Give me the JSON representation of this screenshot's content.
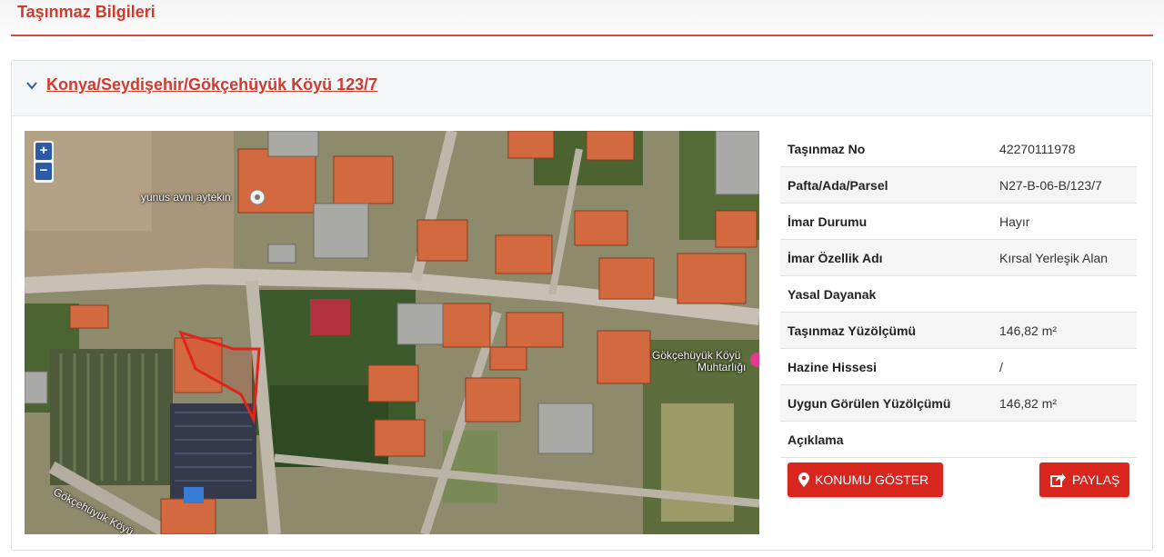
{
  "page": {
    "title": "Taşınmaz Bilgileri"
  },
  "panel": {
    "header_link": "Konya/Seydişehir/Gökçehüyük Köyü 123/7"
  },
  "map": {
    "zoom_in": "+",
    "zoom_out": "−",
    "labels": {
      "poi_user": "yunus avni aytekin",
      "poi_office_line1": "Gökçehüyük Köyü",
      "poi_office_line2": "Muhtarlığı",
      "road": "Gökçehüyük Köyü"
    }
  },
  "details": {
    "rows": [
      {
        "label": "Taşınmaz No",
        "value": "42270111978"
      },
      {
        "label": "Pafta/Ada/Parsel",
        "value": "N27-B-06-B/123/7"
      },
      {
        "label": "İmar Durumu",
        "value": "Hayır"
      },
      {
        "label": "İmar Özellik Adı",
        "value": "Kırsal Yerleşik Alan"
      },
      {
        "label": "Yasal Dayanak",
        "value": ""
      },
      {
        "label": "Taşınmaz Yüzölçümü",
        "value": "146,82 m²"
      },
      {
        "label": "Hazine Hissesi",
        "value": "/"
      },
      {
        "label": "Uygun Görülen Yüzölçümü",
        "value": "146,82 m²"
      },
      {
        "label": "Açıklama",
        "value": ""
      }
    ]
  },
  "actions": {
    "show_location": "KONUMU GÖSTER",
    "share": "PAYLAŞ"
  },
  "colors": {
    "accent": "#d0392c",
    "button": "#d8251e",
    "map_blue": "#2b5ba8"
  }
}
